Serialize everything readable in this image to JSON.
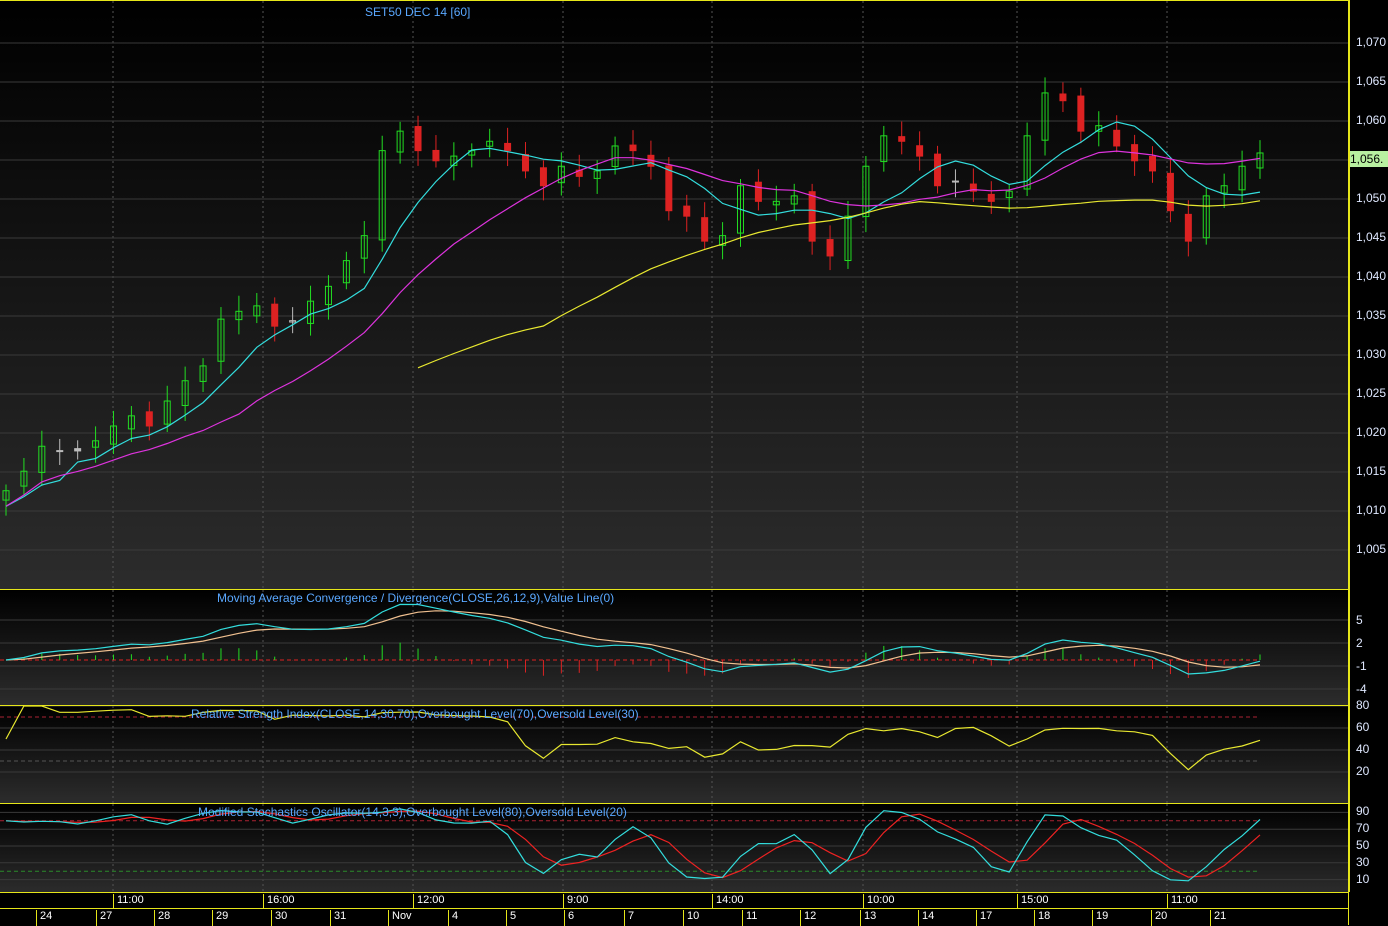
{
  "title": "SET50 DEC 14   [60]",
  "last_price": "1,056.",
  "colors": {
    "up": "#22dd22",
    "down": "#dd2222",
    "doji": "#bbbbbb",
    "ma_fast": "#33dddd",
    "ma_mid": "#dd33dd",
    "ma_slow": "#e8e830",
    "macd": "#33dddd",
    "signal": "#f0c090",
    "rsi": "#e8e830",
    "stoch_k": "#33dddd",
    "stoch_d": "#ee2222",
    "border": "#e6e619"
  },
  "panels": {
    "macd_title": "Moving Average Convergence / Divergence(CLOSE,26,12,9),Value Line(0)",
    "rsi_title": "Relative Strength Index(CLOSE,14,30,70),Overbought Level(70),Oversold Level(30)",
    "stoch_title": "Modified Stochastics Oscillator(14,3,3),Overbought Level(80),Oversold Level(20)"
  },
  "price_axis": [
    "1,070",
    "1,065",
    "1,060",
    "1,050",
    "1,045",
    "1,040",
    "1,035",
    "1,030",
    "1,025",
    "1,020",
    "1,015",
    "1,010",
    "1,005"
  ],
  "macd_axis": [
    "5",
    "2",
    "-1",
    "-4"
  ],
  "rsi_axis": [
    "80",
    "60",
    "40",
    "20"
  ],
  "stoch_axis": [
    "90",
    "70",
    "50",
    "30",
    "10"
  ],
  "time_labels": [
    "11:00",
    "16:00",
    "12:00",
    "9:00",
    "14:00",
    "10:00",
    "15:00",
    "11:00"
  ],
  "date_labels": [
    "24",
    "27",
    "28",
    "29",
    "30",
    "31",
    "Nov",
    "4",
    "5",
    "6",
    "7",
    "10",
    "11",
    "12",
    "13",
    "14",
    "17",
    "18",
    "19",
    "20",
    "21"
  ],
  "chart_data": {
    "type": "candlestick",
    "title": "SET50 DEC 14 [60]",
    "ylim": [
      1000,
      1073
    ],
    "closes": [
      1012.6,
      1015.1,
      1018.3,
      1017.7,
      1017.7,
      1019.0,
      1020.9,
      1022.2,
      1020.9,
      1024.1,
      1026.7,
      1028.6,
      1034.6,
      1035.6,
      1036.3,
      1033.7,
      1034.4,
      1036.9,
      1038.8,
      1042.1,
      1045.3,
      1056.2,
      1058.7,
      1056.2,
      1054.9,
      1055.5,
      1056.2,
      1057.4,
      1056.2,
      1053.6,
      1051.7,
      1054.2,
      1052.9,
      1053.6,
      1056.8,
      1056.2,
      1054.2,
      1048.5,
      1047.8,
      1044.6,
      1045.3,
      1051.7,
      1049.7,
      1049.7,
      1050.4,
      1044.6,
      1042.7,
      1047.8,
      1054.2,
      1058.1,
      1057.4,
      1055.5,
      1051.7,
      1052.3,
      1051.0,
      1049.7,
      1051.0,
      1058.1,
      1063.6,
      1062.6,
      1058.7,
      1059.4,
      1056.8,
      1054.9,
      1053.6,
      1048.5,
      1044.6,
      1050.4,
      1051.7,
      1054.2,
      1055.9
    ],
    "moving_averages": [
      "fast",
      "mid",
      "slow"
    ],
    "rsi_levels": [
      70,
      30
    ],
    "stoch_levels": [
      80,
      20
    ]
  }
}
